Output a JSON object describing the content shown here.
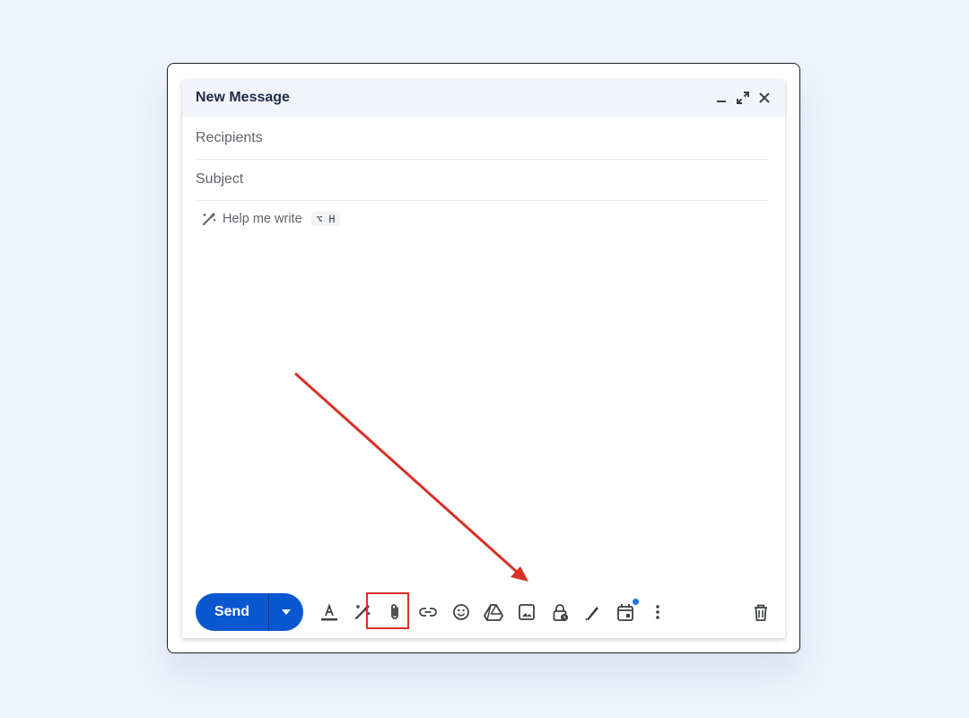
{
  "compose": {
    "title": "New Message",
    "header_icons": [
      "minimize-icon",
      "expand-icon",
      "close-icon"
    ],
    "recipients_placeholder": "Recipients",
    "subject_placeholder": "Subject",
    "help_me_write": {
      "label": "Help me write",
      "shortcut": "⌥ H",
      "icon": "pen-sparkle-icon"
    },
    "send": {
      "label": "Send",
      "dropdown_icon": "caret-down-icon"
    },
    "toolbar_icons": [
      "formatting-options-icon",
      "help-me-write-icon",
      "attach-files-icon",
      "insert-link-icon",
      "insert-emoji-icon",
      "insert-drive-icon",
      "insert-photo-icon",
      "confidential-mode-icon",
      "insert-signature-icon",
      "schedule-event-icon",
      "more-options-icon",
      "discard-draft-icon"
    ],
    "highlighted_icon": "confidential-mode-icon"
  },
  "colors": {
    "background": "#eef3fd",
    "send_button": "#0b57d0",
    "header": "#f2f6fc",
    "annotation": "#d93025",
    "notification_dot": "#1a73e8"
  }
}
